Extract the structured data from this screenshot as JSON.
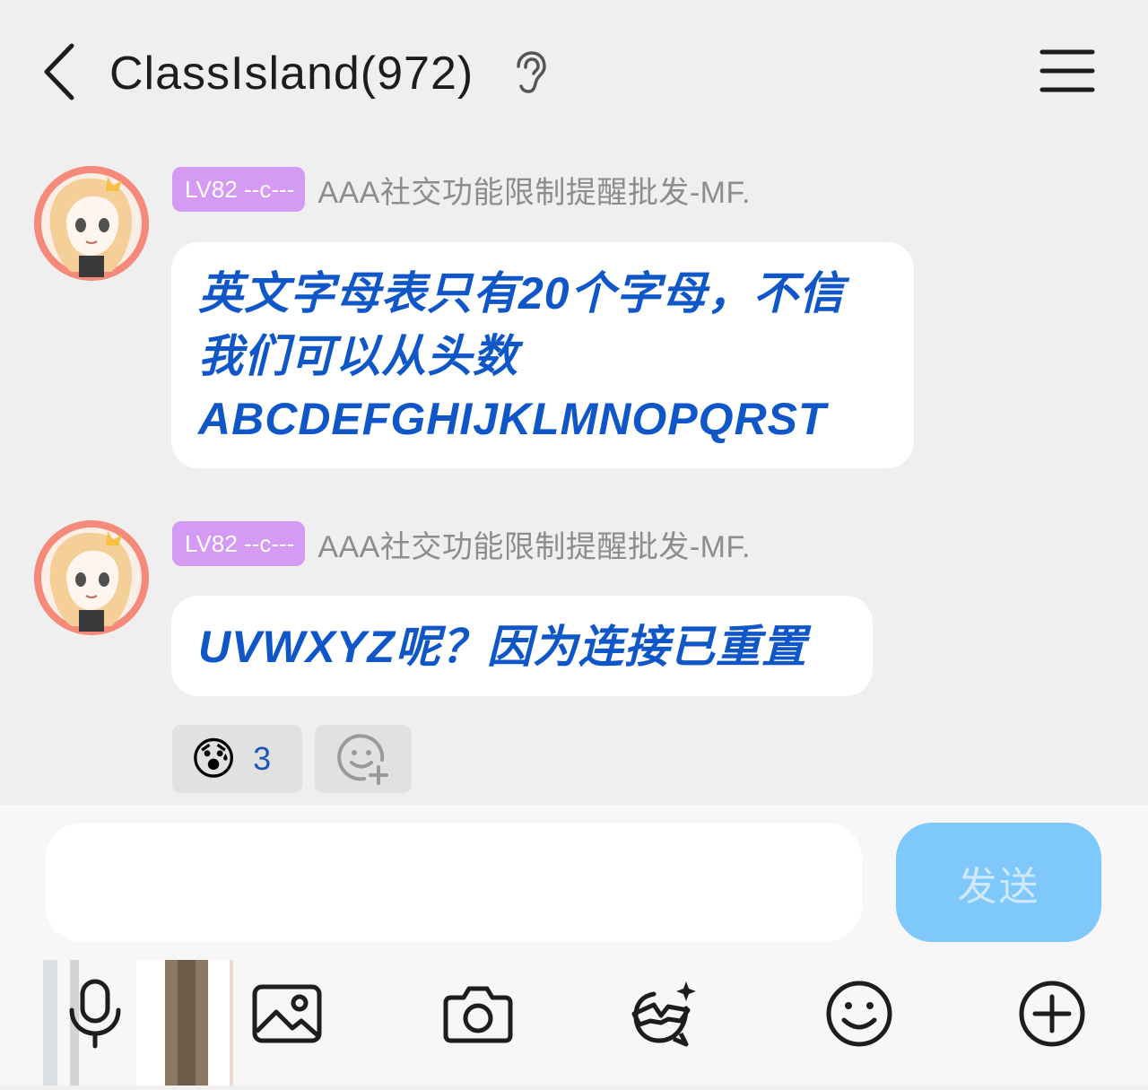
{
  "header": {
    "back_icon": "chevron-left-icon",
    "title": "ClassIsland(972)",
    "ear_icon": "ear-icon",
    "menu_icon": "hamburger-menu-icon"
  },
  "messages": [
    {
      "badge": "LV82 --c---",
      "nickname": "AAA社交功能限制提醒批发-MF.",
      "lines": [
        "英文字母表只有20个字母，不信",
        "我们可以从头数",
        "ABCDEFGHIJKLMNOPQRST"
      ]
    },
    {
      "badge": "LV82 --c---",
      "nickname": "AAA社交功能限制提醒批发-MF.",
      "lines": [
        "UVWXYZ呢？因为连接已重置"
      ]
    }
  ],
  "reactions": {
    "emoji": "😰",
    "count": "3",
    "add_icon": "add-reaction-icon"
  },
  "composer": {
    "input_value": "",
    "send_label": "发送"
  },
  "toolbar": {
    "items": [
      "microphone-icon",
      "image-icon",
      "camera-icon",
      "sticker-icon",
      "emoji-icon",
      "plus-icon"
    ]
  },
  "colors": {
    "background": "#efefef",
    "bubble_text": "#0f56c9",
    "badge": "#d49af4",
    "send_button": "#7ec8fb"
  }
}
